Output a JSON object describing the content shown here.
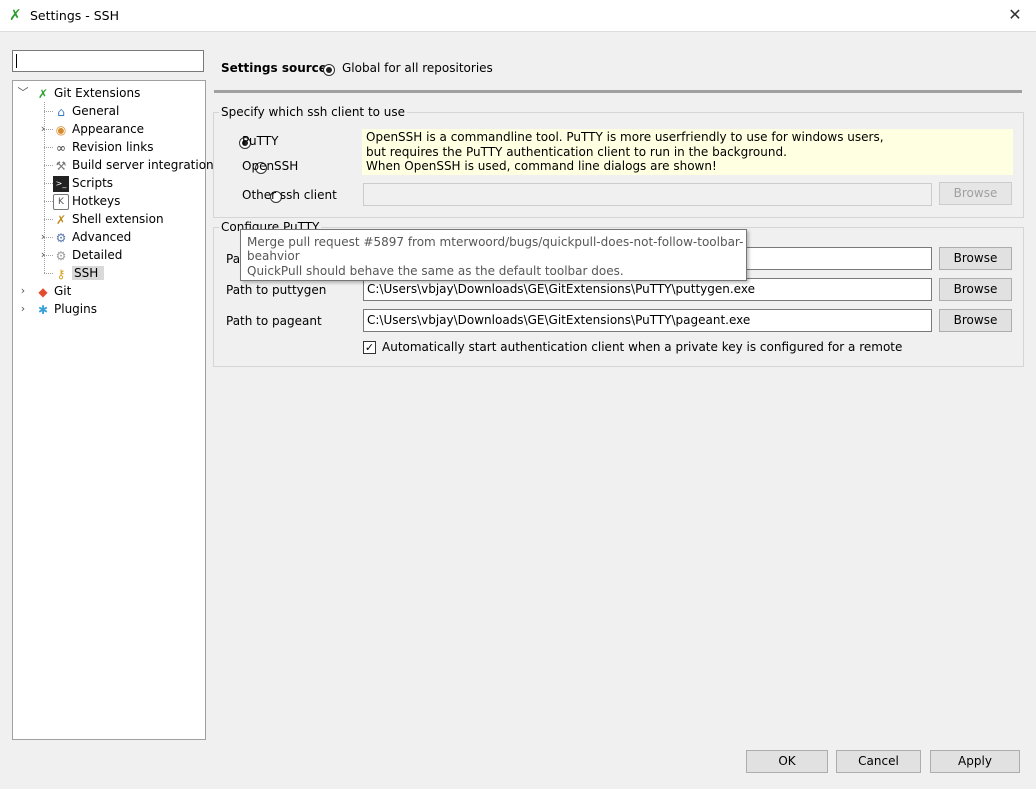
{
  "window": {
    "title": "Settings - SSH",
    "close_glyph": "✕"
  },
  "tree": {
    "items": [
      {
        "name": "git-extensions",
        "label": "Git Extensions",
        "icon": "git-extensions-icon",
        "expander": "﹀",
        "glyph": "✗",
        "color": "#2e9e2e"
      },
      {
        "name": "general",
        "label": "General",
        "icon": "home-icon",
        "glyph": "⌂",
        "color": "#3b7cc6"
      },
      {
        "name": "appearance",
        "label": "Appearance",
        "icon": "palette-icon",
        "expander": "›",
        "glyph": "◉",
        "color": "#d98b2b"
      },
      {
        "name": "revision-links",
        "label": "Revision links",
        "icon": "link-icon",
        "glyph": "∞",
        "color": "#333333"
      },
      {
        "name": "build-server-integration",
        "label": "Build server integration",
        "icon": "build-icon",
        "glyph": "⚒",
        "color": "#777777"
      },
      {
        "name": "scripts",
        "label": "Scripts",
        "icon": "console-icon",
        "glyph": ">_",
        "color": "#ffffff"
      },
      {
        "name": "hotkeys",
        "label": "Hotkeys",
        "icon": "keyboard-icon",
        "glyph": "K",
        "color": "#555555"
      },
      {
        "name": "shell-extension",
        "label": "Shell extension",
        "icon": "shell-icon",
        "glyph": "✗",
        "color": "#c08a1e"
      },
      {
        "name": "advanced",
        "label": "Advanced",
        "icon": "wrench-icon",
        "expander": "›",
        "glyph": "⚙",
        "color": "#5577aa"
      },
      {
        "name": "detailed",
        "label": "Detailed",
        "icon": "gear-icon",
        "expander": "›",
        "glyph": "⚙",
        "color": "#999999"
      },
      {
        "name": "ssh",
        "label": "SSH",
        "icon": "key-icon",
        "glyph": "⚷",
        "color": "#d4a017"
      },
      {
        "name": "git",
        "label": "Git",
        "icon": "git-icon",
        "expander": "›",
        "glyph": "◆",
        "color": "#e44c30"
      },
      {
        "name": "plugins",
        "label": "Plugins",
        "icon": "puzzle-icon",
        "expander": "›",
        "glyph": "✱",
        "color": "#3aa0d8"
      }
    ]
  },
  "settings_source": {
    "label": "Settings source:",
    "option": "Global for all repositories"
  },
  "ssh_client": {
    "group_title": "Specify which ssh client to use",
    "options": {
      "putty": "PuTTY",
      "openssh": "OpenSSH",
      "other": "Other ssh client"
    },
    "selected": "putty",
    "note_lines": [
      "OpenSSH is a commandline tool. PuTTY is more userfriendly to use for windows users,",
      "but requires the PuTTY authentication client to run  in the background.",
      "When OpenSSH is used, command line dialogs are shown!"
    ],
    "other_value": "",
    "browse_label": "Browse"
  },
  "configure_putty": {
    "group_title": "Configure PuTTY",
    "plink_label_partial": "Pat",
    "plink_value": "",
    "puttygen_label": "Path to puttygen",
    "puttygen_value": "C:\\Users\\vbjay\\Downloads\\GE\\GitExtensions\\PuTTY\\puttygen.exe",
    "pageant_label": "Path to pageant",
    "pageant_value": "C:\\Users\\vbjay\\Downloads\\GE\\GitExtensions\\PuTTY\\pageant.exe",
    "browse_label": "Browse",
    "autostart_label": "Automatically start authentication client when a private key is configured for a remote",
    "autostart_checked": true,
    "check_glyph": "✓"
  },
  "tooltip": {
    "line1": "Merge pull request #5897 from mterwoord/bugs/quickpull-does-not-follow-toolbar-beahvior",
    "line2": "QuickPull should behave the same as the default toolbar does."
  },
  "footer": {
    "ok": "OK",
    "cancel": "Cancel",
    "apply": "Apply"
  }
}
